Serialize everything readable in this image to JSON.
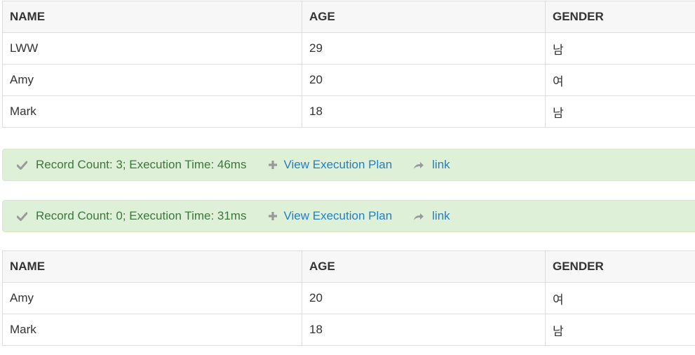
{
  "table1": {
    "headers": [
      "NAME",
      "AGE",
      "GENDER"
    ],
    "rows": [
      [
        "LWW",
        "29",
        "남"
      ],
      [
        "Amy",
        "20",
        "여"
      ],
      [
        "Mark",
        "18",
        "남"
      ]
    ]
  },
  "result1": {
    "status": "Record Count: 3; Execution Time: 46ms",
    "plan_label": "View Execution Plan",
    "link_label": "link"
  },
  "result2": {
    "status": "Record Count: 0; Execution Time: 31ms",
    "plan_label": "View Execution Plan",
    "link_label": "link"
  },
  "table2": {
    "headers": [
      "NAME",
      "AGE",
      "GENDER"
    ],
    "rows": [
      [
        "Amy",
        "20",
        "여"
      ],
      [
        "Mark",
        "18",
        "남"
      ]
    ]
  },
  "icons": {
    "status": "check-icon",
    "plan": "plus-icon",
    "link": "share-icon"
  },
  "colors": {
    "success_bg": "#dff0d8",
    "success_text": "#3c763d",
    "link": "#1f7fc5",
    "header_bg": "#f7f7f7",
    "border": "#dddddd"
  }
}
